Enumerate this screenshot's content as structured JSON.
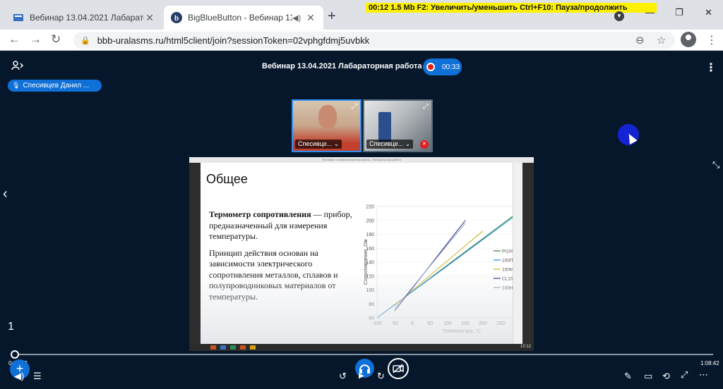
{
  "browser": {
    "tabs": [
      {
        "label": "Вебинар 13.04.2021 Лабараторн",
        "close": "✕"
      },
      {
        "label": "BigBlueButton - Вебинар 13",
        "close": "✕"
      }
    ],
    "new_tab": "+",
    "hint_bar": "00:12     1.5 Mb        F2: Увеличить/уменьшить      Ctrl+F10: Пауза/продолжить",
    "profile_icon": "chevron-down-icon",
    "window_controls": {
      "minimize": "—",
      "maximize": "❐",
      "close": "✕"
    },
    "url": "bbb-uralasms.ru/html5client/join?sessionToken=02vphgfdmj5uvbkk"
  },
  "meeting": {
    "title": "Вебинар 13.04.2021 Лабараторная работа ...",
    "recording_time": "00:33",
    "talking_indicator": "Спесивцев Данил ...",
    "webcams": [
      {
        "name": "Спесивце... ⌄"
      },
      {
        "name": "Спесивце... ⌄"
      }
    ],
    "slide_number": "1"
  },
  "slide": {
    "topbar": "Тепловые и механические процессы - Лабораторная работа",
    "title": "Общее",
    "term": "Термометр сопротивления",
    "definition": " — прибор, предназначенный для измерения температуры.",
    "principle": "Принцип действия основан на зависимости электрического сопротивления металлов, сплавов и полупроводниковых материалов от температуры.",
    "taskbar_clock": "10:12"
  },
  "chart_data": {
    "type": "line",
    "xlabel": "Температура, °С",
    "ylabel": "Сопротивление, Ом",
    "xlim": [
      -100,
      300
    ],
    "ylim": [
      60,
      220
    ],
    "xticks": [
      -100,
      -50,
      0,
      50,
      100,
      150,
      200,
      250,
      300
    ],
    "yticks": [
      60,
      80,
      100,
      120,
      140,
      160,
      180,
      200,
      220
    ],
    "series": [
      {
        "name": "Pt100",
        "color": "#2e7d32",
        "x": [
          -100,
          300
        ],
        "y": [
          60,
          212
        ]
      },
      {
        "name": "100П",
        "color": "#1e88e5",
        "x": [
          -100,
          300
        ],
        "y": [
          60,
          210
        ]
      },
      {
        "name": "100М",
        "color": "#c6b21f",
        "x": [
          -50,
          200
        ],
        "y": [
          78,
          185
        ]
      },
      {
        "name": "CL100",
        "color": "#1a237e",
        "x": [
          -50,
          150
        ],
        "y": [
          70,
          200
        ]
      },
      {
        "name": "100Н",
        "color": "#8aa2c8",
        "x": [
          -50,
          150
        ],
        "y": [
          73,
          196
        ]
      }
    ]
  },
  "player": {
    "current_time": "0:00:12",
    "total_time": "1:08:42",
    "progress_fraction": 0.005
  }
}
